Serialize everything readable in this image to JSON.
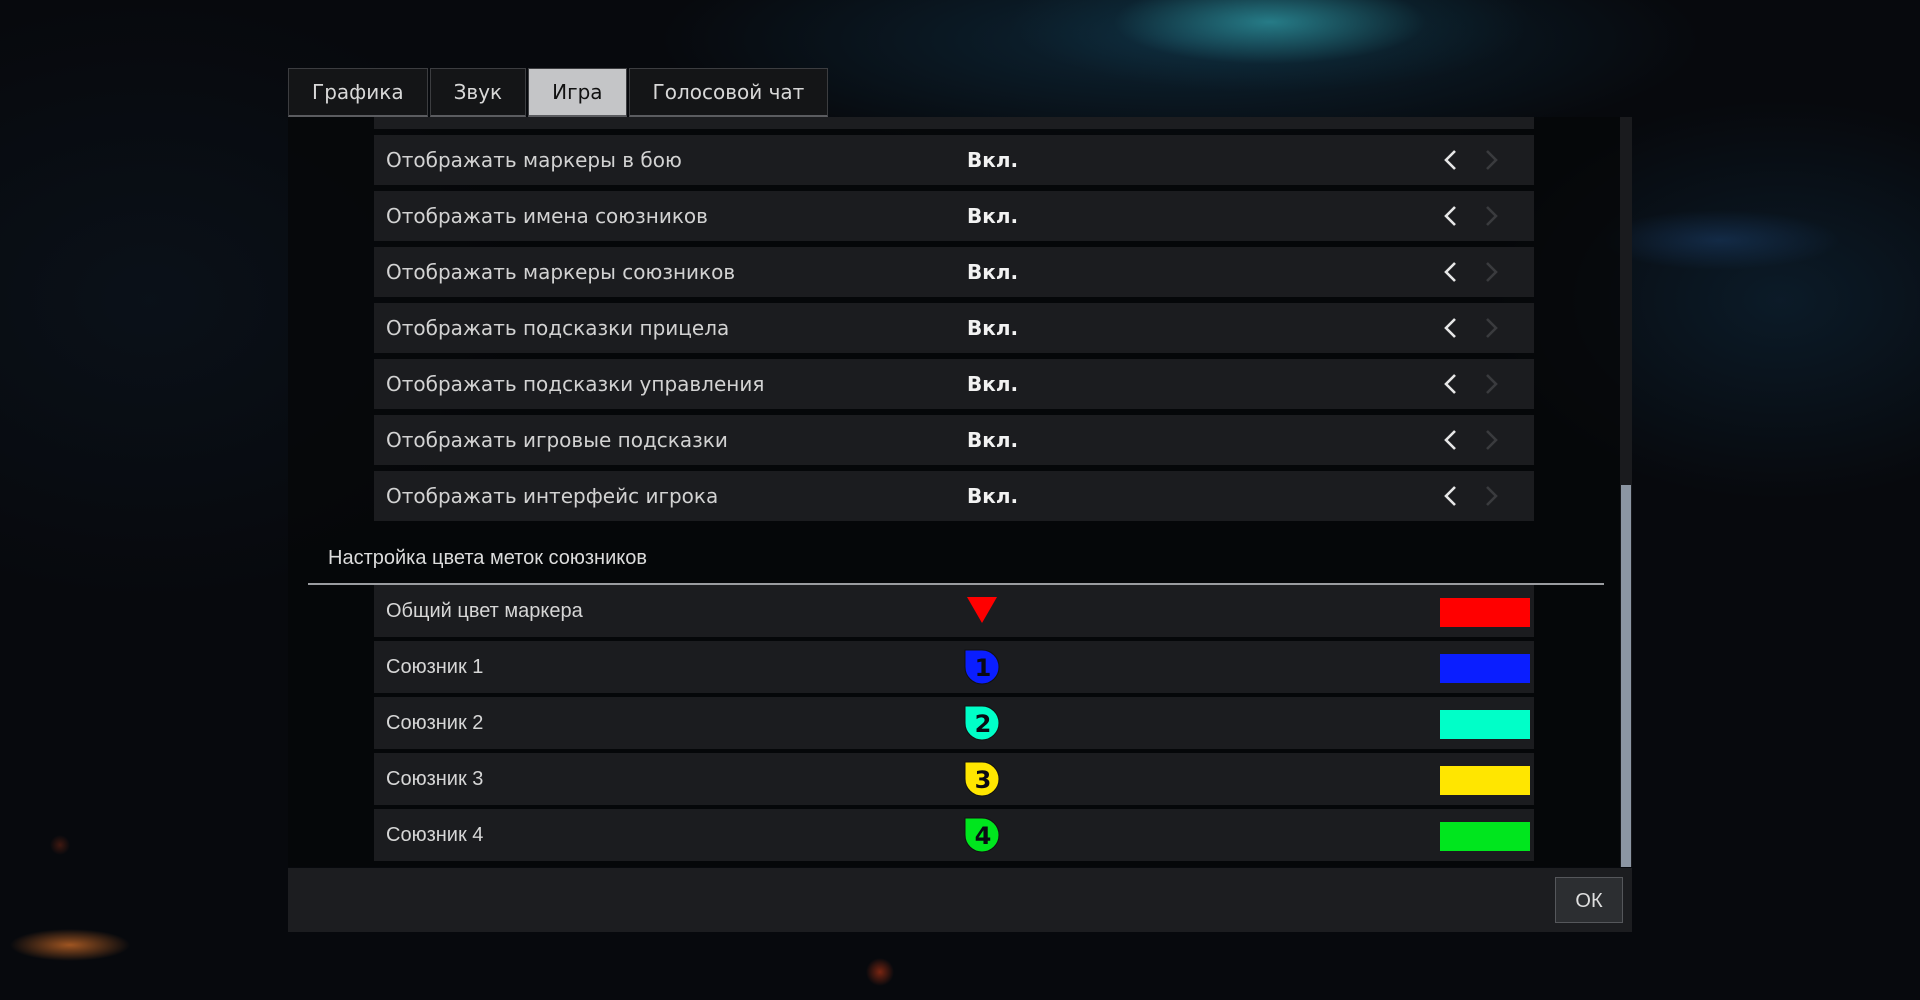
{
  "tabs": [
    {
      "label": "Графика",
      "active": false
    },
    {
      "label": "Звук",
      "active": false
    },
    {
      "label": "Игра",
      "active": true
    },
    {
      "label": "Голосовой чат",
      "active": false
    }
  ],
  "settings": [
    {
      "label": "Отображать маркеры в бою",
      "value": "Вкл."
    },
    {
      "label": "Отображать имена союзников",
      "value": "Вкл."
    },
    {
      "label": "Отображать маркеры союзников",
      "value": "Вкл."
    },
    {
      "label": "Отображать подсказки прицела",
      "value": "Вкл."
    },
    {
      "label": "Отображать подсказки управления",
      "value": "Вкл."
    },
    {
      "label": "Отображать игровые подсказки",
      "value": "Вкл."
    },
    {
      "label": "Отображать интерфейс игрока",
      "value": "Вкл."
    }
  ],
  "marker_colors": {
    "title": "Настройка цвета меток союзников",
    "rows": [
      {
        "label": "Общий цвет маркера",
        "icon": "triangle-marker-icon",
        "color": "#ff0000"
      },
      {
        "label": "Союзник 1",
        "icon": "ally-1-marker-icon",
        "number": "1",
        "color": "#0a1eff"
      },
      {
        "label": "Союзник 2",
        "icon": "ally-2-marker-icon",
        "number": "2",
        "color": "#00ffc8"
      },
      {
        "label": "Союзник 3",
        "icon": "ally-3-marker-icon",
        "number": "3",
        "color": "#ffe600"
      },
      {
        "label": "Союзник 4",
        "icon": "ally-4-marker-icon",
        "number": "4",
        "color": "#00e61e"
      }
    ]
  },
  "footer": {
    "ok_label": "ОК"
  }
}
